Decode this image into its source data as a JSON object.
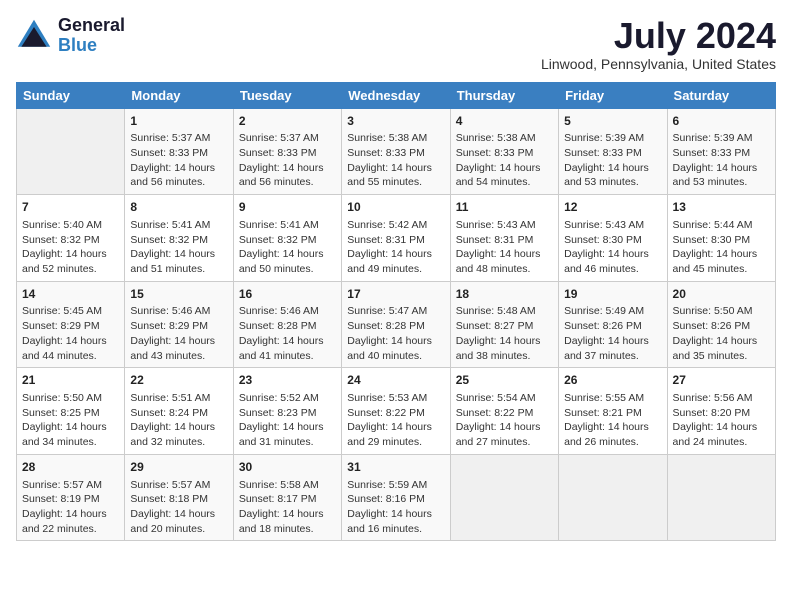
{
  "logo": {
    "general": "General",
    "blue": "Blue"
  },
  "title": {
    "month_year": "July 2024",
    "location": "Linwood, Pennsylvania, United States"
  },
  "headers": [
    "Sunday",
    "Monday",
    "Tuesday",
    "Wednesday",
    "Thursday",
    "Friday",
    "Saturday"
  ],
  "weeks": [
    [
      {
        "day": "",
        "info": ""
      },
      {
        "day": "1",
        "info": "Sunrise: 5:37 AM\nSunset: 8:33 PM\nDaylight: 14 hours\nand 56 minutes."
      },
      {
        "day": "2",
        "info": "Sunrise: 5:37 AM\nSunset: 8:33 PM\nDaylight: 14 hours\nand 56 minutes."
      },
      {
        "day": "3",
        "info": "Sunrise: 5:38 AM\nSunset: 8:33 PM\nDaylight: 14 hours\nand 55 minutes."
      },
      {
        "day": "4",
        "info": "Sunrise: 5:38 AM\nSunset: 8:33 PM\nDaylight: 14 hours\nand 54 minutes."
      },
      {
        "day": "5",
        "info": "Sunrise: 5:39 AM\nSunset: 8:33 PM\nDaylight: 14 hours\nand 53 minutes."
      },
      {
        "day": "6",
        "info": "Sunrise: 5:39 AM\nSunset: 8:33 PM\nDaylight: 14 hours\nand 53 minutes."
      }
    ],
    [
      {
        "day": "7",
        "info": "Sunrise: 5:40 AM\nSunset: 8:32 PM\nDaylight: 14 hours\nand 52 minutes."
      },
      {
        "day": "8",
        "info": "Sunrise: 5:41 AM\nSunset: 8:32 PM\nDaylight: 14 hours\nand 51 minutes."
      },
      {
        "day": "9",
        "info": "Sunrise: 5:41 AM\nSunset: 8:32 PM\nDaylight: 14 hours\nand 50 minutes."
      },
      {
        "day": "10",
        "info": "Sunrise: 5:42 AM\nSunset: 8:31 PM\nDaylight: 14 hours\nand 49 minutes."
      },
      {
        "day": "11",
        "info": "Sunrise: 5:43 AM\nSunset: 8:31 PM\nDaylight: 14 hours\nand 48 minutes."
      },
      {
        "day": "12",
        "info": "Sunrise: 5:43 AM\nSunset: 8:30 PM\nDaylight: 14 hours\nand 46 minutes."
      },
      {
        "day": "13",
        "info": "Sunrise: 5:44 AM\nSunset: 8:30 PM\nDaylight: 14 hours\nand 45 minutes."
      }
    ],
    [
      {
        "day": "14",
        "info": "Sunrise: 5:45 AM\nSunset: 8:29 PM\nDaylight: 14 hours\nand 44 minutes."
      },
      {
        "day": "15",
        "info": "Sunrise: 5:46 AM\nSunset: 8:29 PM\nDaylight: 14 hours\nand 43 minutes."
      },
      {
        "day": "16",
        "info": "Sunrise: 5:46 AM\nSunset: 8:28 PM\nDaylight: 14 hours\nand 41 minutes."
      },
      {
        "day": "17",
        "info": "Sunrise: 5:47 AM\nSunset: 8:28 PM\nDaylight: 14 hours\nand 40 minutes."
      },
      {
        "day": "18",
        "info": "Sunrise: 5:48 AM\nSunset: 8:27 PM\nDaylight: 14 hours\nand 38 minutes."
      },
      {
        "day": "19",
        "info": "Sunrise: 5:49 AM\nSunset: 8:26 PM\nDaylight: 14 hours\nand 37 minutes."
      },
      {
        "day": "20",
        "info": "Sunrise: 5:50 AM\nSunset: 8:26 PM\nDaylight: 14 hours\nand 35 minutes."
      }
    ],
    [
      {
        "day": "21",
        "info": "Sunrise: 5:50 AM\nSunset: 8:25 PM\nDaylight: 14 hours\nand 34 minutes."
      },
      {
        "day": "22",
        "info": "Sunrise: 5:51 AM\nSunset: 8:24 PM\nDaylight: 14 hours\nand 32 minutes."
      },
      {
        "day": "23",
        "info": "Sunrise: 5:52 AM\nSunset: 8:23 PM\nDaylight: 14 hours\nand 31 minutes."
      },
      {
        "day": "24",
        "info": "Sunrise: 5:53 AM\nSunset: 8:22 PM\nDaylight: 14 hours\nand 29 minutes."
      },
      {
        "day": "25",
        "info": "Sunrise: 5:54 AM\nSunset: 8:22 PM\nDaylight: 14 hours\nand 27 minutes."
      },
      {
        "day": "26",
        "info": "Sunrise: 5:55 AM\nSunset: 8:21 PM\nDaylight: 14 hours\nand 26 minutes."
      },
      {
        "day": "27",
        "info": "Sunrise: 5:56 AM\nSunset: 8:20 PM\nDaylight: 14 hours\nand 24 minutes."
      }
    ],
    [
      {
        "day": "28",
        "info": "Sunrise: 5:57 AM\nSunset: 8:19 PM\nDaylight: 14 hours\nand 22 minutes."
      },
      {
        "day": "29",
        "info": "Sunrise: 5:57 AM\nSunset: 8:18 PM\nDaylight: 14 hours\nand 20 minutes."
      },
      {
        "day": "30",
        "info": "Sunrise: 5:58 AM\nSunset: 8:17 PM\nDaylight: 14 hours\nand 18 minutes."
      },
      {
        "day": "31",
        "info": "Sunrise: 5:59 AM\nSunset: 8:16 PM\nDaylight: 14 hours\nand 16 minutes."
      },
      {
        "day": "",
        "info": ""
      },
      {
        "day": "",
        "info": ""
      },
      {
        "day": "",
        "info": ""
      }
    ]
  ]
}
